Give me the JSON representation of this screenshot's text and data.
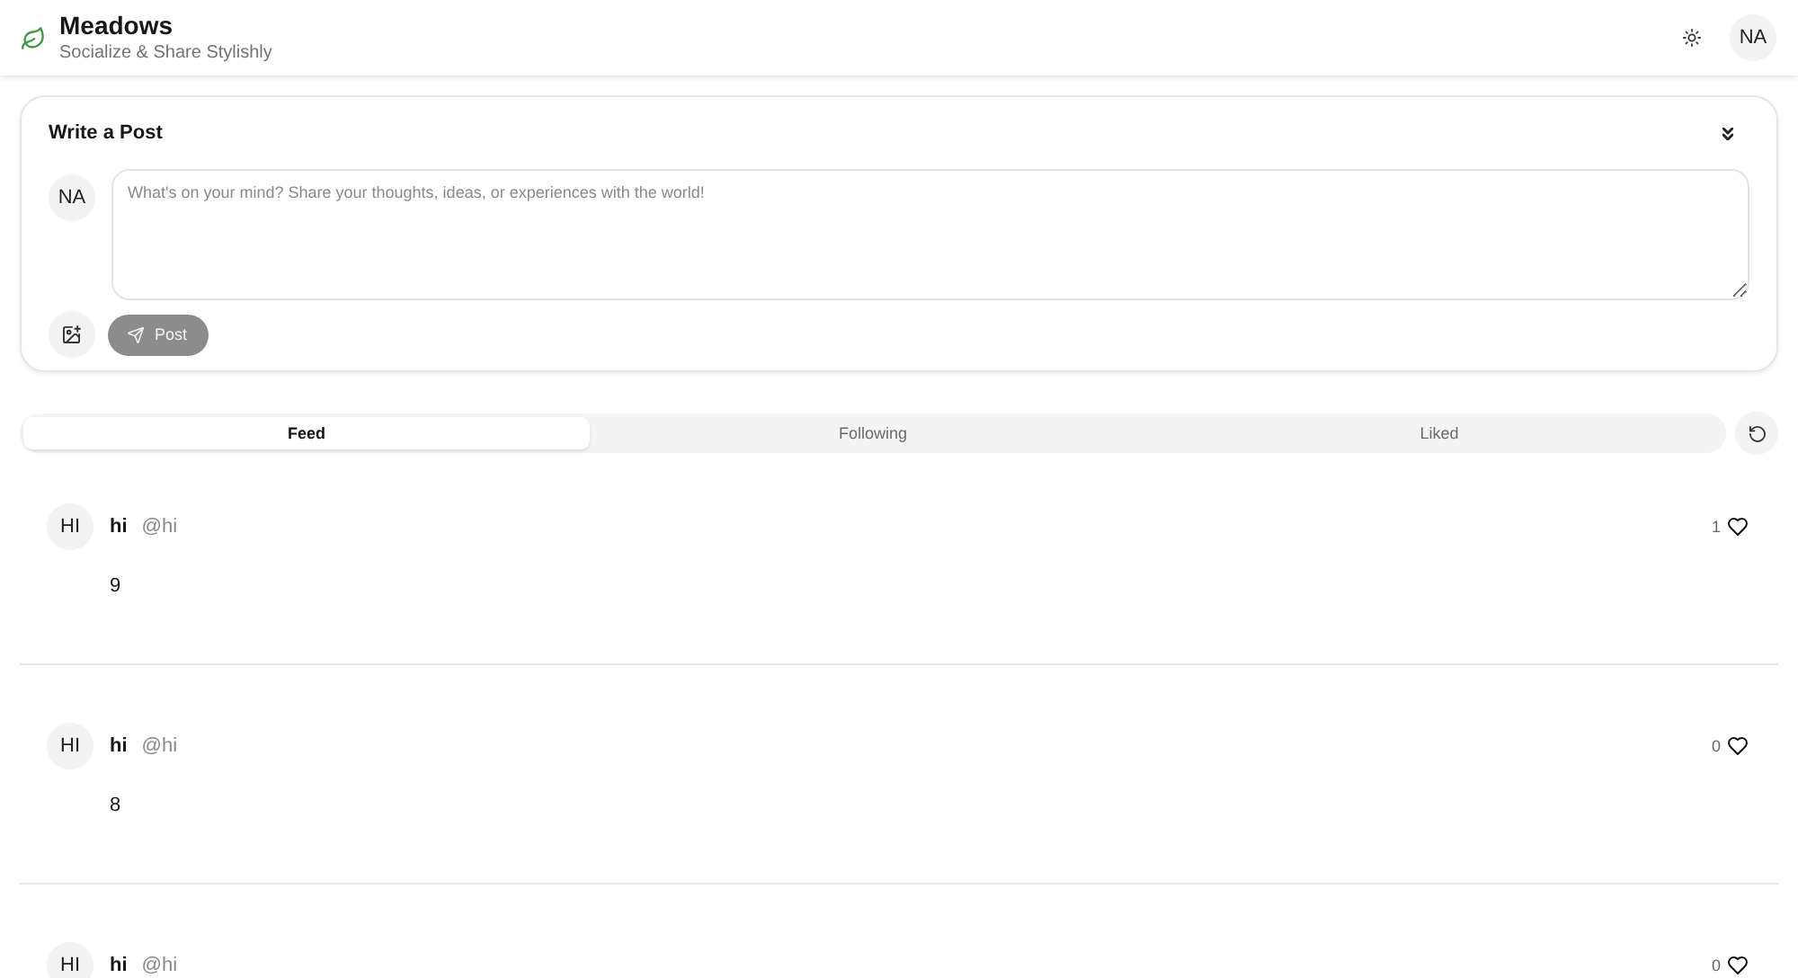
{
  "header": {
    "title": "Meadows",
    "subtitle": "Socialize & Share Stylishly",
    "avatar_initials": "NA"
  },
  "composer": {
    "title": "Write a Post",
    "avatar_initials": "NA",
    "placeholder": "What's on your mind? Share your thoughts, ideas, or experiences with the world!",
    "post_button": {
      "label": "Post",
      "disabled": true
    }
  },
  "tabs": [
    {
      "label": "Feed",
      "selected": true
    },
    {
      "label": "Following",
      "selected": false
    },
    {
      "label": "Liked",
      "selected": false
    }
  ],
  "posts": [
    {
      "avatar_initials": "HI",
      "name": "hi",
      "handle": "@hi",
      "content": "9",
      "likes": "1",
      "liked": false
    },
    {
      "avatar_initials": "HI",
      "name": "hi",
      "handle": "@hi",
      "content": "8",
      "likes": "0",
      "liked": false
    },
    {
      "avatar_initials": "HI",
      "name": "hi",
      "handle": "@hi",
      "likes": "0",
      "liked": false
    }
  ]
}
